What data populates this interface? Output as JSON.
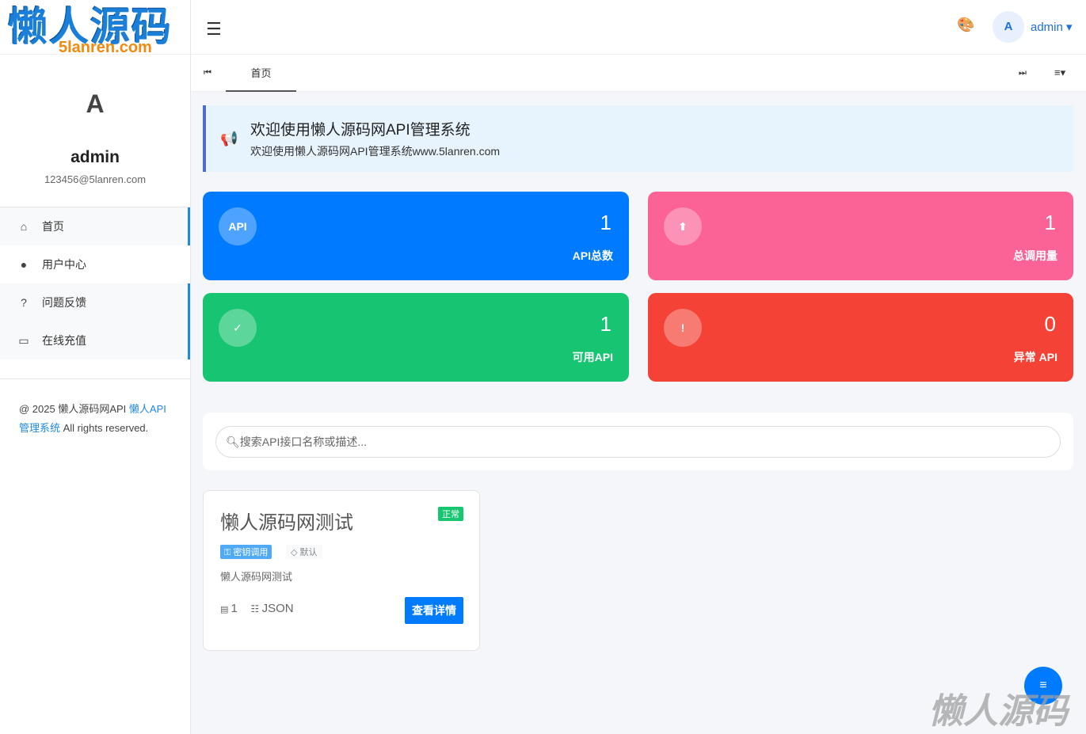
{
  "logo": {
    "text": "懒人源码",
    "domain": "5lanren.com"
  },
  "profile": {
    "avatar": "A",
    "name": "admin",
    "email": "123456@5lanren.com"
  },
  "sidebar": {
    "items": [
      {
        "label": "首页",
        "icon": "home-icon"
      },
      {
        "label": "用户中心",
        "icon": "user-circle-icon"
      },
      {
        "label": "问题反馈",
        "icon": "question-icon"
      },
      {
        "label": "在线充值",
        "icon": "credit-card-icon"
      }
    ]
  },
  "footer": {
    "prefix": "@ 2025 懒人源码网API ",
    "link": "懒人API管理系统",
    "suffix": " All rights reserved."
  },
  "topbar": {
    "avatar": "A",
    "username": "admin"
  },
  "tabs": [
    {
      "label": "首页"
    }
  ],
  "notice": {
    "title": "欢迎使用懒人源码网API管理系统",
    "text": "欢迎使用懒人源码网API管理系统www.5lanren.com"
  },
  "stats": [
    {
      "value": "1",
      "label": "API总数",
      "icon_text": "API",
      "color": "#007bff"
    },
    {
      "value": "1",
      "label": "总调用量",
      "icon_text": "⬆",
      "color": "#fb6396"
    },
    {
      "value": "1",
      "label": "可用API",
      "icon_text": "✓",
      "color": "#17c471"
    },
    {
      "value": "0",
      "label": "异常 API",
      "icon_text": "!",
      "color": "#f44336"
    }
  ],
  "search": {
    "placeholder": "搜索API接口名称或描述..."
  },
  "api_card": {
    "title": "懒人源码网测试",
    "status": "正常",
    "tag_auth": "密钥调用",
    "tag_category": "默认",
    "description": "懒人源码网测试",
    "count": "1",
    "format": "JSON",
    "button": "查看详情"
  },
  "watermark": "懒人源码"
}
